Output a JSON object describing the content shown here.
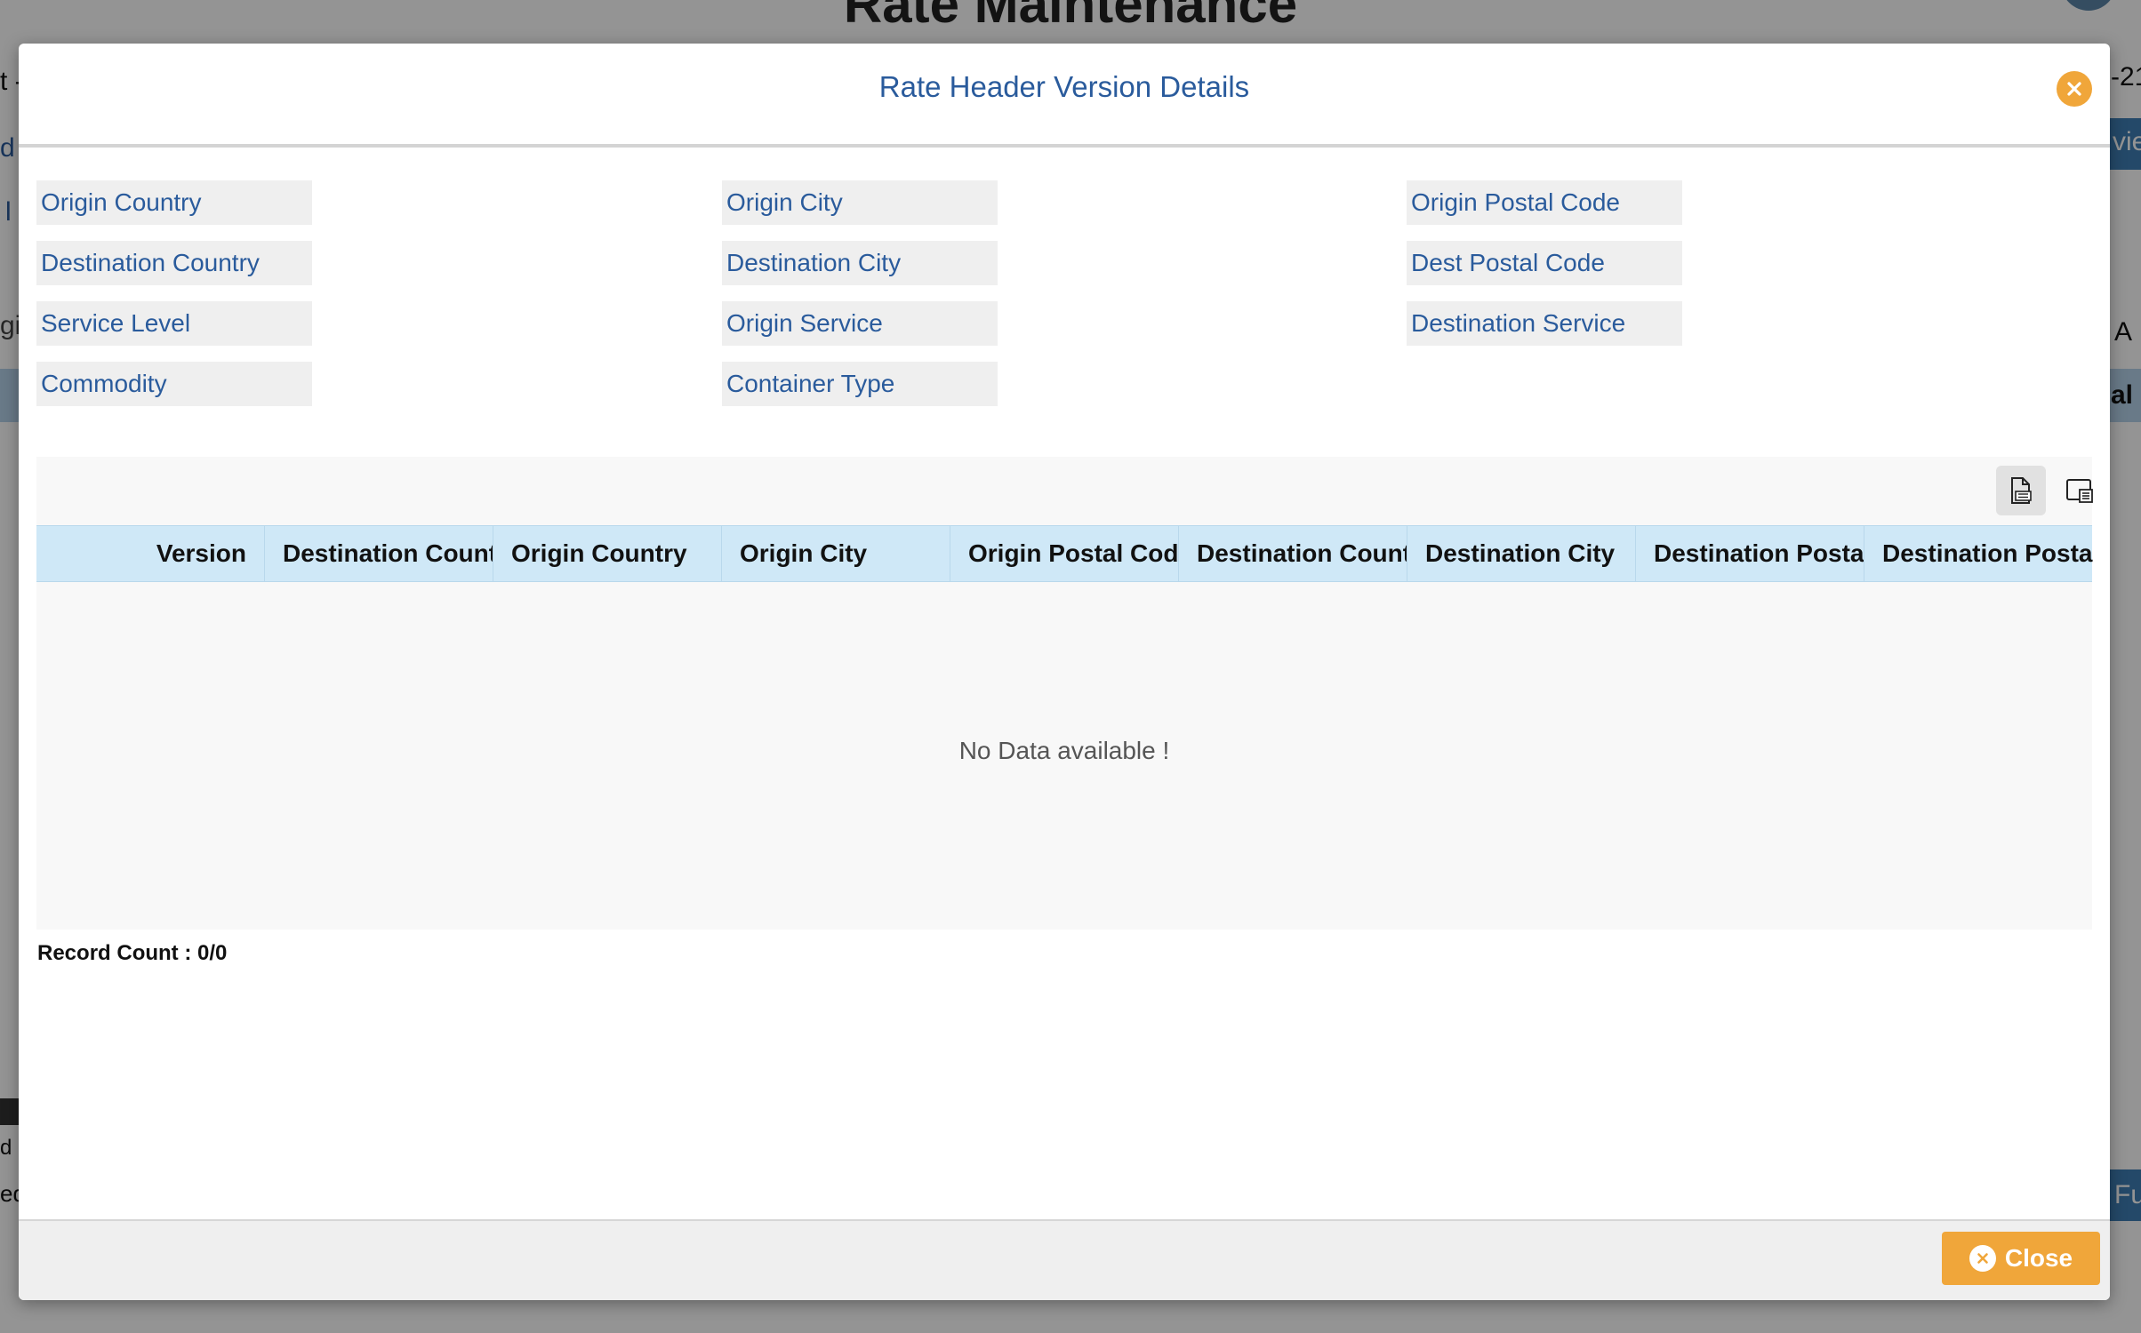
{
  "background": {
    "page_title": "Rate Maintenance",
    "fragments": [
      "t -",
      "d I",
      "l R",
      "gi",
      "-21",
      "vie",
      "A",
      "al C",
      "d (",
      "eq",
      "Fu"
    ]
  },
  "modal": {
    "title": "Rate Header Version Details",
    "fields": [
      "Origin Country",
      "Origin City",
      "Origin Postal Code",
      "Destination Country",
      "Destination City",
      "Dest Postal Code",
      "Service Level",
      "Origin Service",
      "Destination Service",
      "Commodity",
      "Container Type"
    ],
    "toolbar": {
      "export_icon": "export-document-icon",
      "columns_icon": "column-chooser-icon"
    },
    "grid": {
      "columns": [
        "Version",
        "Destination Country",
        "Origin Country",
        "Origin City",
        "Origin Postal Code",
        "Destination Country",
        "Destination City",
        "Destination Postal Code",
        "Destination Postal Code"
      ],
      "empty_message": "No Data available !"
    },
    "record_count": "Record Count : 0/0",
    "footer": {
      "close_label": "Close"
    }
  },
  "colors": {
    "accent": "#f0a63a",
    "title_blue": "#2a5b9c",
    "grid_header": "#cfe8f7"
  }
}
